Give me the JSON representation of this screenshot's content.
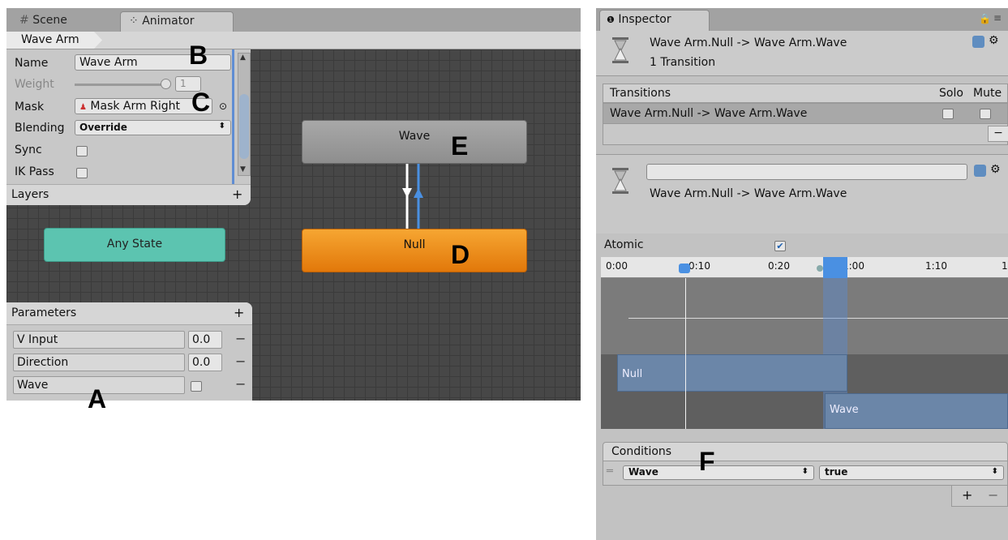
{
  "animator": {
    "tabs": [
      {
        "label": "Scene",
        "icon": "grid-icon"
      },
      {
        "label": "Animator",
        "icon": "animator-icon"
      }
    ],
    "breadcrumb": "Wave Arm",
    "layer": {
      "name_label": "Name",
      "name_value": "Wave Arm",
      "weight_label": "Weight",
      "weight_value": "1",
      "mask_label": "Mask",
      "mask_value": "Mask Arm Right",
      "blending_label": "Blending",
      "blending_value": "Override",
      "sync_label": "Sync",
      "ik_label": "IK Pass"
    },
    "layers_header": "Layers",
    "layers_add": "+",
    "nodes": {
      "any_state": "Any State",
      "wave": "Wave",
      "null": "Null"
    },
    "parameters_header": "Parameters",
    "parameters_add": "+",
    "parameters": [
      {
        "name": "V Input",
        "value": "0.0",
        "remove": "−"
      },
      {
        "name": "Direction",
        "value": "0.0",
        "remove": "−"
      },
      {
        "name": "Wave",
        "value": "",
        "remove": "−"
      }
    ]
  },
  "inspector": {
    "tab": "Inspector",
    "title": "Wave Arm.Null -> Wave Arm.Wave",
    "subtitle": "1 Transition",
    "transitions_header": "Transitions",
    "solo_label": "Solo",
    "mute_label": "Mute",
    "transition_row": "Wave Arm.Null -> Wave Arm.Wave",
    "remove": "−",
    "detail_name": "Wave Arm.Null -> Wave Arm.Wave",
    "atomic_label": "Atomic",
    "atomic_checked": true,
    "ruler": [
      "0:00",
      "0:10",
      "0:20",
      "1:00",
      "1:10",
      "1"
    ],
    "clip_null": "Null",
    "clip_wave": "Wave",
    "conditions_header": "Conditions",
    "condition_param": "Wave",
    "condition_value": "true",
    "cond_add": "+",
    "cond_remove": "−"
  },
  "annotations": {
    "a": "A",
    "b": "B",
    "c": "C",
    "d": "D",
    "e": "E",
    "f": "F"
  },
  "colors": {
    "any_state": "#5cc4b0",
    "null_node": "#f08e16",
    "wave_node": "#9c9c9c",
    "transition_arrow": "#4a90e2",
    "clip_blue": "#6b86a8"
  }
}
